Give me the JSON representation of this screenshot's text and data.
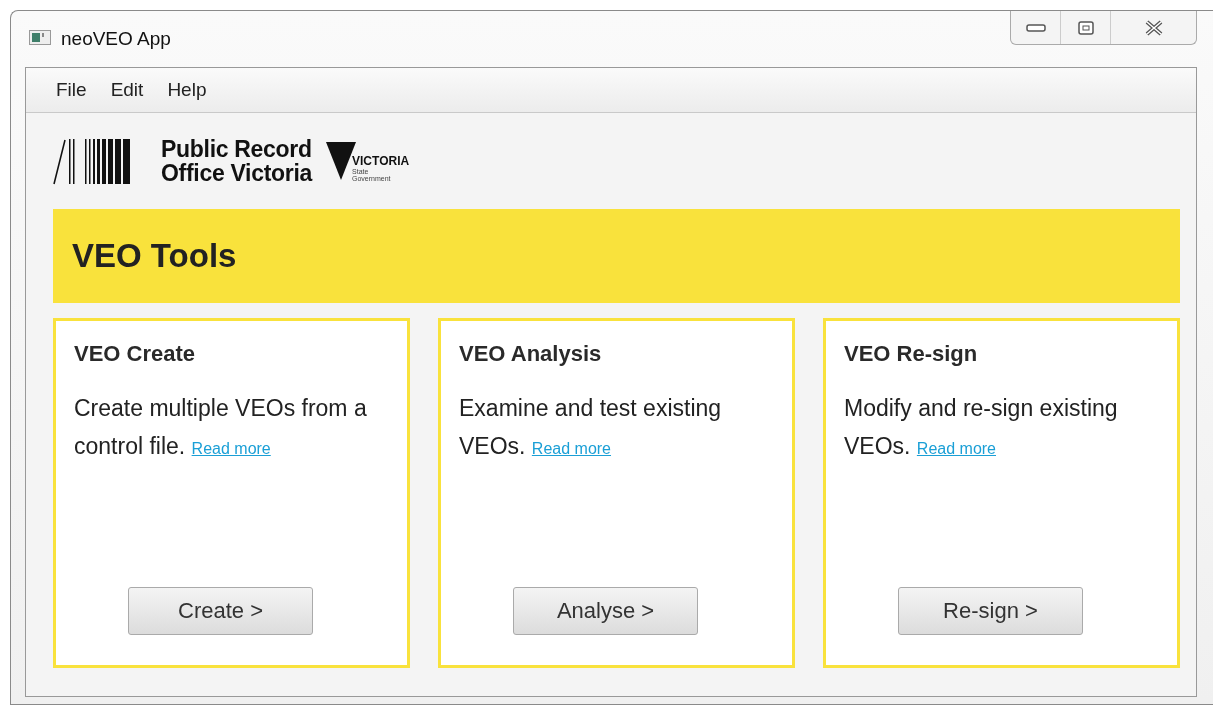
{
  "window": {
    "title": "neoVEO App"
  },
  "menu": [
    "File",
    "Edit",
    "Help"
  ],
  "logo": {
    "name_line_1": "Public Record",
    "name_line_2": "Office Victoria",
    "state_mark": "VICTORIA",
    "state_caption": "State Government"
  },
  "banner": {
    "title": "VEO Tools"
  },
  "cards": [
    {
      "title": "VEO Create",
      "description": "Create multiple VEOs from a control file.",
      "link": "Read more",
      "button": "Create >"
    },
    {
      "title": "VEO Analysis",
      "description": "Examine and test existing VEOs.",
      "link": "Read more",
      "button": "Analyse >"
    },
    {
      "title": "VEO Re-sign",
      "description": "Modify and re-sign existing VEOs.",
      "link": "Read more",
      "button": "Re-sign >"
    }
  ]
}
